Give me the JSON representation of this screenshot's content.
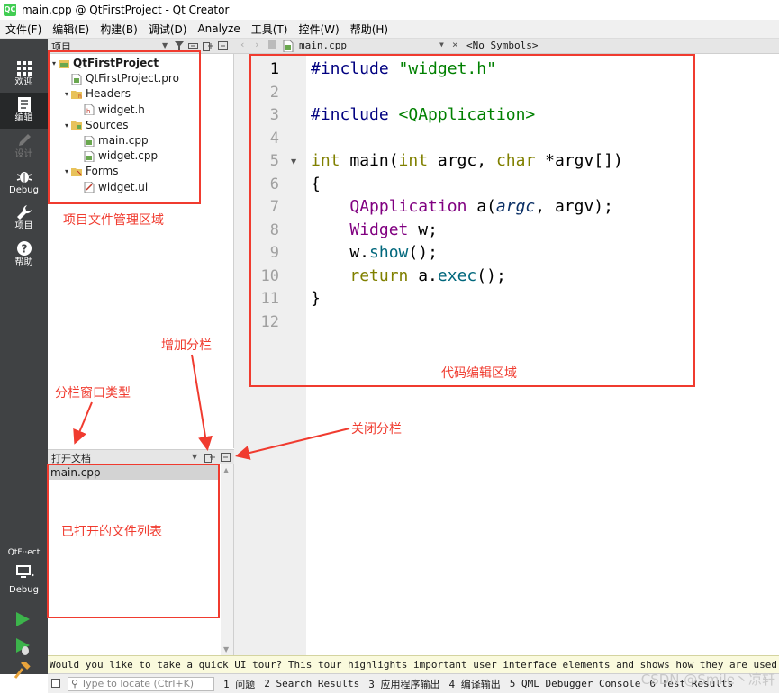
{
  "window": {
    "app_icon": "QC",
    "title": "main.cpp @ QtFirstProject - Qt Creator"
  },
  "menu": [
    "文件(F)",
    "编辑(E)",
    "构建(B)",
    "调试(D)",
    "Analyze",
    "工具(T)",
    "控件(W)",
    "帮助(H)"
  ],
  "modes": [
    {
      "label": "欢迎",
      "icon": "grid-icon",
      "state": "normal"
    },
    {
      "label": "编辑",
      "icon": "edit-icon",
      "state": "active"
    },
    {
      "label": "设计",
      "icon": "pencil-icon",
      "state": "disabled"
    },
    {
      "label": "Debug",
      "icon": "bug-icon",
      "state": "normal"
    },
    {
      "label": "项目",
      "icon": "wrench-icon",
      "state": "normal"
    },
    {
      "label": "帮助",
      "icon": "help-icon",
      "state": "normal"
    }
  ],
  "kit": {
    "name": "QtF··ect",
    "mode": "Debug"
  },
  "project_pane": {
    "title": "项目",
    "tree": [
      {
        "label": "QtFirstProject",
        "level": 0,
        "expanded": true,
        "icon": "project-icon",
        "bold": true
      },
      {
        "label": "QtFirstProject.pro",
        "level": 1,
        "icon": "pro-file-icon"
      },
      {
        "label": "Headers",
        "level": 1,
        "expanded": true,
        "icon": "headers-folder-icon"
      },
      {
        "label": "widget.h",
        "level": 2,
        "icon": "header-file-icon"
      },
      {
        "label": "Sources",
        "level": 1,
        "expanded": true,
        "icon": "sources-folder-icon"
      },
      {
        "label": "main.cpp",
        "level": 2,
        "icon": "cpp-file-icon"
      },
      {
        "label": "widget.cpp",
        "level": 2,
        "icon": "cpp-file-icon"
      },
      {
        "label": "Forms",
        "level": 1,
        "expanded": true,
        "icon": "forms-folder-icon"
      },
      {
        "label": "widget.ui",
        "level": 2,
        "icon": "ui-file-icon"
      }
    ]
  },
  "docs_pane": {
    "title": "打开文档",
    "items": [
      "main.cpp"
    ]
  },
  "editor": {
    "file_tab": "main.cpp",
    "symbols": "<No Symbols>",
    "current_line": 1,
    "lines": [
      [
        {
          "t": "#include ",
          "c": "pre"
        },
        {
          "t": "\"widget.h\"",
          "c": "str"
        }
      ],
      [],
      [
        {
          "t": "#include ",
          "c": "pre"
        },
        {
          "t": "<QApplication>",
          "c": "str"
        }
      ],
      [],
      [
        {
          "t": "int ",
          "c": "kw"
        },
        {
          "t": "main(",
          "c": ""
        },
        {
          "t": "int ",
          "c": "kw"
        },
        {
          "t": "argc, ",
          "c": ""
        },
        {
          "t": "char ",
          "c": "kw"
        },
        {
          "t": "*argv[])",
          "c": ""
        }
      ],
      [
        {
          "t": "{",
          "c": ""
        }
      ],
      [
        {
          "t": "    ",
          "c": ""
        },
        {
          "t": "QApplication",
          "c": "cls"
        },
        {
          "t": " a(",
          "c": ""
        },
        {
          "t": "argc",
          "c": "par"
        },
        {
          "t": ", argv);",
          "c": ""
        }
      ],
      [
        {
          "t": "    ",
          "c": ""
        },
        {
          "t": "Widget",
          "c": "cls"
        },
        {
          "t": " w;",
          "c": ""
        }
      ],
      [
        {
          "t": "    w.",
          "c": ""
        },
        {
          "t": "show",
          "c": "fn"
        },
        {
          "t": "();",
          "c": ""
        }
      ],
      [
        {
          "t": "    ",
          "c": ""
        },
        {
          "t": "return ",
          "c": "kw"
        },
        {
          "t": "a.",
          "c": ""
        },
        {
          "t": "exec",
          "c": "fn"
        },
        {
          "t": "();",
          "c": ""
        }
      ],
      [
        {
          "t": "}",
          "c": ""
        }
      ],
      []
    ]
  },
  "annotations": {
    "project_area": "项目文件管理区域",
    "code_area": "代码编辑区域",
    "add_split": "增加分栏",
    "split_type": "分栏窗口类型",
    "close_split": "关闭分栏",
    "opened_files": "已打开的文件列表"
  },
  "infobar": {
    "text": "Would you like to take a quick UI tour? This tour highlights important user interface elements and shows how they are used. To take the"
  },
  "statusbar": {
    "locator_placeholder": "Type to locate (Ctrl+K)",
    "tabs": [
      "1 问题",
      "2 Search Results",
      "3 应用程序输出",
      "4 编译输出",
      "5 QML Debugger Console",
      "6 Test Results"
    ]
  },
  "watermark": "CSDN @Smile丶凉轩",
  "colors": {
    "annotation_red": "#f03b2f",
    "modebar": "#404244",
    "run_green": "#3cb44b"
  }
}
